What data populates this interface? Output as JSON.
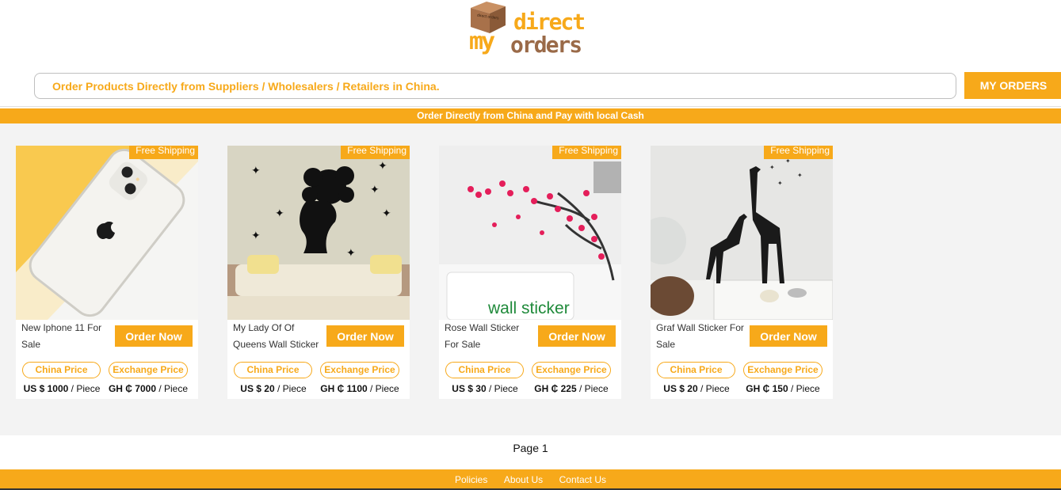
{
  "logo": {
    "box_text": "direct orders",
    "line1": "direct",
    "line2_a": "my",
    "line2_b": "orders",
    "colors": {
      "orange": "#f7a91a",
      "brown": "#9a6a48"
    }
  },
  "search": {
    "placeholder": "Order Products Directly from Suppliers / Wholesalers / Retailers in China."
  },
  "header": {
    "my_orders_label": "MY ORDERS"
  },
  "banner": {
    "text": "Order Directly from China and Pay with local Cash"
  },
  "products": [
    {
      "badge": "Free Shipping",
      "title": "New Iphone 11 For Sale",
      "order_label": "Order Now",
      "china_label": "China Price",
      "exchange_label": "Exchange Price",
      "china_price": "US $ 1000",
      "china_unit": " / Piece",
      "exchange_price": "GH ₵ 7000",
      "exchange_unit": " / Piece",
      "image": "phone"
    },
    {
      "badge": "Free Shipping",
      "title": "My Lady Of Of Queens Wall Sticker",
      "order_label": "Order Now",
      "china_label": "China Price",
      "exchange_label": "Exchange Price",
      "china_price": "US $ 20",
      "china_unit": " / Piece",
      "exchange_price": "GH ₵ 1100",
      "exchange_unit": " / Piece",
      "image": "lady"
    },
    {
      "badge": "Free Shipping",
      "title": "Rose Wall Sticker For Sale",
      "order_label": "Order Now",
      "china_label": "China Price",
      "exchange_label": "Exchange Price",
      "china_price": "US $ 30",
      "china_unit": " / Piece",
      "exchange_price": "GH ₵ 225",
      "exchange_unit": " / Piece",
      "image": "rose",
      "image_caption": "wall sticker"
    },
    {
      "badge": "Free Shipping",
      "title": "Graf Wall Sticker For Sale",
      "order_label": "Order Now",
      "china_label": "China Price",
      "exchange_label": "Exchange Price",
      "china_price": "US $ 20",
      "china_unit": " / Piece",
      "exchange_price": "GH ₵ 150",
      "exchange_unit": " / Piece",
      "image": "giraffe"
    }
  ],
  "pagination": {
    "label": "Page 1"
  },
  "footer": {
    "links": [
      "Policies",
      "About Us",
      "Contact Us"
    ]
  }
}
